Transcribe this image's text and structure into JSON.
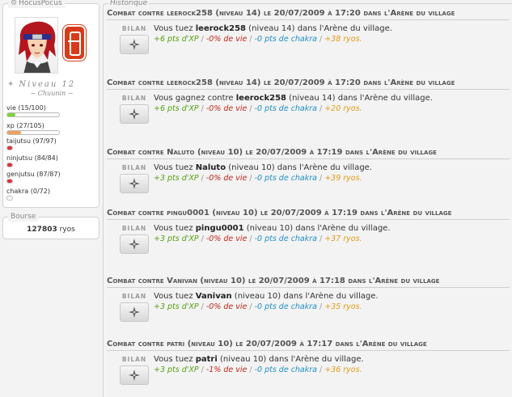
{
  "player": {
    "name": "HocusPocus",
    "level": "Niveau 12",
    "rank": "~ Chuunin ~",
    "stats": [
      {
        "label": "vie (15/100)",
        "fraction": 0.15,
        "color": "#7dd33b"
      },
      {
        "label": "xp (27/105)",
        "fraction": 0.26,
        "color": "#f0a060"
      },
      {
        "label": "taijutsu (97/97)",
        "fraction": 1.0,
        "color": "#d8313b"
      },
      {
        "label": "ninjutsu (84/84)",
        "fraction": 1.0,
        "color": "#d8313b"
      },
      {
        "label": "genjutsu (87/87)",
        "fraction": 1.0,
        "color": "#d8313b"
      },
      {
        "label": "chakra (0/72)",
        "fraction": 0.0,
        "color": "#bfe3f7"
      }
    ]
  },
  "bourse": {
    "title": "Bourse",
    "amount": "127803",
    "unit": "ryos"
  },
  "historique": {
    "title": "Historique",
    "bilan_label": "BILAN",
    "entries": [
      {
        "title": "Combat contre leerock258 (niveau 14) le 20/07/2009 à 17:20 dans l'Arène du village",
        "result_pre": "Vous tuez ",
        "opponent": "leerock258",
        "result_post": " (niveau 14) dans l'Arène du village.",
        "xp": "+6 pts d'XP",
        "vie": "-0% de vie",
        "chakra": "-0 pts de chakra",
        "ryos": "+38 ryos."
      },
      {
        "title": "Combat contre leerock258 (niveau 14) le 20/07/2009 à 17:20 dans l'Arène du village",
        "result_pre": "Vous gagnez contre ",
        "opponent": "leerock258",
        "result_post": " (niveau 14) dans l'Arène du village.",
        "xp": "+6 pts d'XP",
        "vie": "-0% de vie",
        "chakra": "-0 pts de chakra",
        "ryos": "+20 ryos."
      },
      {
        "title": "Combat contre Naluto (niveau 10) le 20/07/2009 à 17:19 dans l'Arène du village",
        "result_pre": "Vous tuez ",
        "opponent": "Naluto",
        "result_post": " (niveau 10) dans l'Arène du village.",
        "xp": "+3 pts d'XP",
        "vie": "-0% de vie",
        "chakra": "-0 pts de chakra",
        "ryos": "+39 ryos."
      },
      {
        "title": "Combat contre pingu0001 (niveau 10) le 20/07/2009 à 17:19 dans l'Arène du village",
        "result_pre": "Vous tuez ",
        "opponent": "pingu0001",
        "result_post": " (niveau 10) dans l'Arène du village.",
        "xp": "+3 pts d'XP",
        "vie": "-0% de vie",
        "chakra": "-0 pts de chakra",
        "ryos": "+37 ryos."
      },
      {
        "title": "Combat contre Vanivan (niveau 10) le 20/07/2009 à 17:18 dans l'Arène du village",
        "result_pre": "Vous tuez ",
        "opponent": "Vanivan",
        "result_post": " (niveau 10) dans l'Arène du village.",
        "xp": "+3 pts d'XP",
        "vie": "-0% de vie",
        "chakra": "-0 pts de chakra",
        "ryos": "+35 ryos."
      },
      {
        "title": "Combat contre patri (niveau 10) le 20/07/2009 à 17:17 dans l'Arène du village",
        "result_pre": "Vous tuez ",
        "opponent": "patri",
        "result_post": " (niveau 10) dans l'Arène du village.",
        "xp": "+3 pts d'XP",
        "vie": "-1% de vie",
        "chakra": "-0 pts de chakra",
        "ryos": "+36 ryos."
      }
    ]
  },
  "icons": {
    "gear": "gear-icon",
    "shuriken": "shuriken-icon",
    "level_star": "shuriken-small-icon"
  }
}
